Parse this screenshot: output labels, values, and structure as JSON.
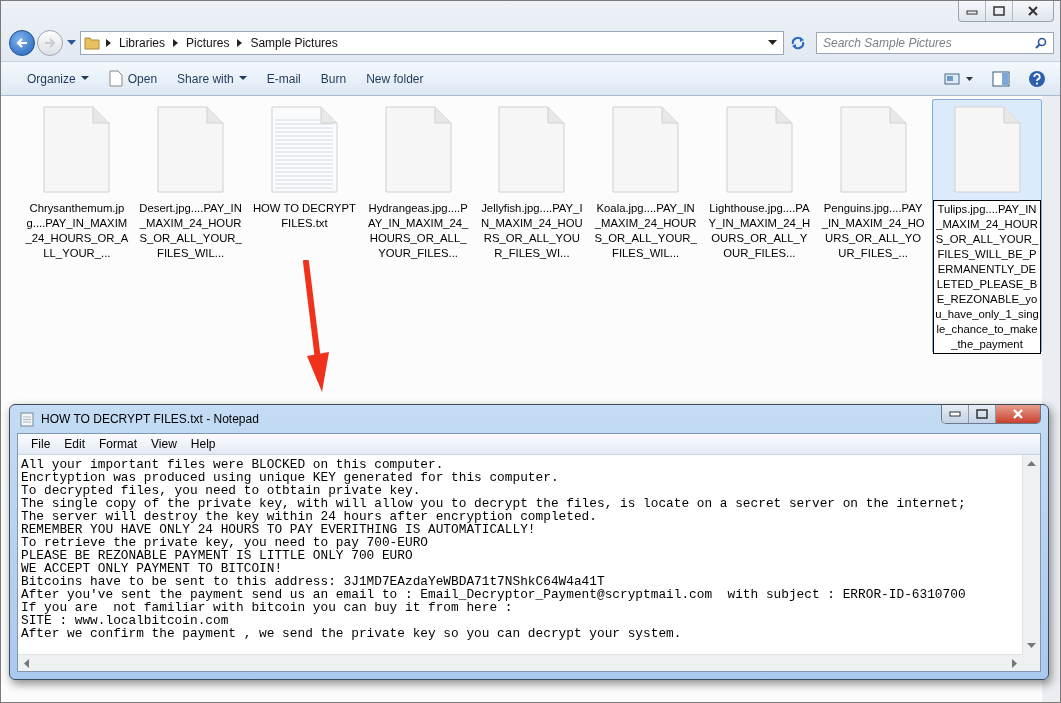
{
  "explorer": {
    "breadcrumb": [
      "Libraries",
      "Pictures",
      "Sample Pictures"
    ],
    "search": {
      "placeholder": "Search Sample Pictures"
    },
    "toolbar": [
      {
        "label": "Organize",
        "kind": "menu"
      },
      {
        "label": "Open",
        "kind": "file"
      },
      {
        "label": "Share with",
        "kind": "menu"
      },
      {
        "label": "E-mail",
        "kind": "plain"
      },
      {
        "label": "Burn",
        "kind": "plain"
      },
      {
        "label": "New folder",
        "kind": "plain"
      }
    ],
    "files": [
      {
        "name": "Chrysanthemum.jpg....PAY_IN_MAXIM_24_HOURS_OR_ALL_YOUR_...",
        "kind": "blank",
        "selected": false
      },
      {
        "name": "Desert.jpg....PAY_IN_MAXIM_24_HOURS_OR_ALL_YOUR_FILES_WIL...",
        "kind": "blank",
        "selected": false
      },
      {
        "name": "HOW TO DECRYPT FILES.txt",
        "kind": "text",
        "selected": false
      },
      {
        "name": "Hydrangeas.jpg....PAY_IN_MAXIM_24_HOURS_OR_ALL_YOUR_FILES...",
        "kind": "blank",
        "selected": false
      },
      {
        "name": "Jellyfish.jpg....PAY_IN_MAXIM_24_HOURS_OR_ALL_YOUR_FILES_WI...",
        "kind": "blank",
        "selected": false
      },
      {
        "name": "Koala.jpg....PAY_IN_MAXIM_24_HOURS_OR_ALL_YOUR_FILES_WIL...",
        "kind": "blank",
        "selected": false
      },
      {
        "name": "Lighthouse.jpg....PAY_IN_MAXIM_24_HOURS_OR_ALL_YOUR_FILES...",
        "kind": "blank",
        "selected": false
      },
      {
        "name": "Penguins.jpg....PAY_IN_MAXIM_24_HOURS_OR_ALL_YOUR_FILES_...",
        "kind": "blank",
        "selected": false
      },
      {
        "name": "Tulips.jpg....PAY_IN_MAXIM_24_HOURS_OR_ALL_YOUR_FILES_WILL_BE_PERMANENTLY_DELETED_PLEASE_BE_REZONABLE_you_have_only_1_single_chance_to_make_the_payment",
        "kind": "blank",
        "selected": true
      }
    ]
  },
  "notepad": {
    "title": "HOW TO DECRYPT FILES.txt - Notepad",
    "menu": [
      "File",
      "Edit",
      "Format",
      "View",
      "Help"
    ],
    "lines": [
      "All your important files were BLOCKED on this computer.",
      "Encrtyption was produced using unique KEY generated for this computer.",
      "To decrypted files, you need to otbtain private key.",
      "The single copy of the private key, with will allow you to decrypt the files, is locate on a secret server on the internet;",
      "The server will destroy the key within 24 hours after encryption completed.",
      "REMEMBER YOU HAVE ONLY 24 HOURS TO PAY EVERITHING IS AUTOMATICALLY!",
      "To retrieve the private key, you need to pay 700-EURO",
      "PLEASE BE REZONABLE PAYMENT IS LITTLE ONLY 700 EURO",
      "WE ACCEPT ONLY PAYMENT TO BITCOIN!",
      "Bitcoins have to be sent to this address: 3J1MD7EAzdaYeWBDA71t7NShkC64W4a41T",
      "After you've sent the payment send us an email to : Email_Decryptor_Payment@scryptmail.com  with subject : ERROR-ID-6310700",
      "If you are  not familiar with bitcoin you can buy it from here :",
      "SITE : www.localbitcoin.com",
      "After we confirm the payment , we send the private key so you can decrypt your system."
    ]
  }
}
